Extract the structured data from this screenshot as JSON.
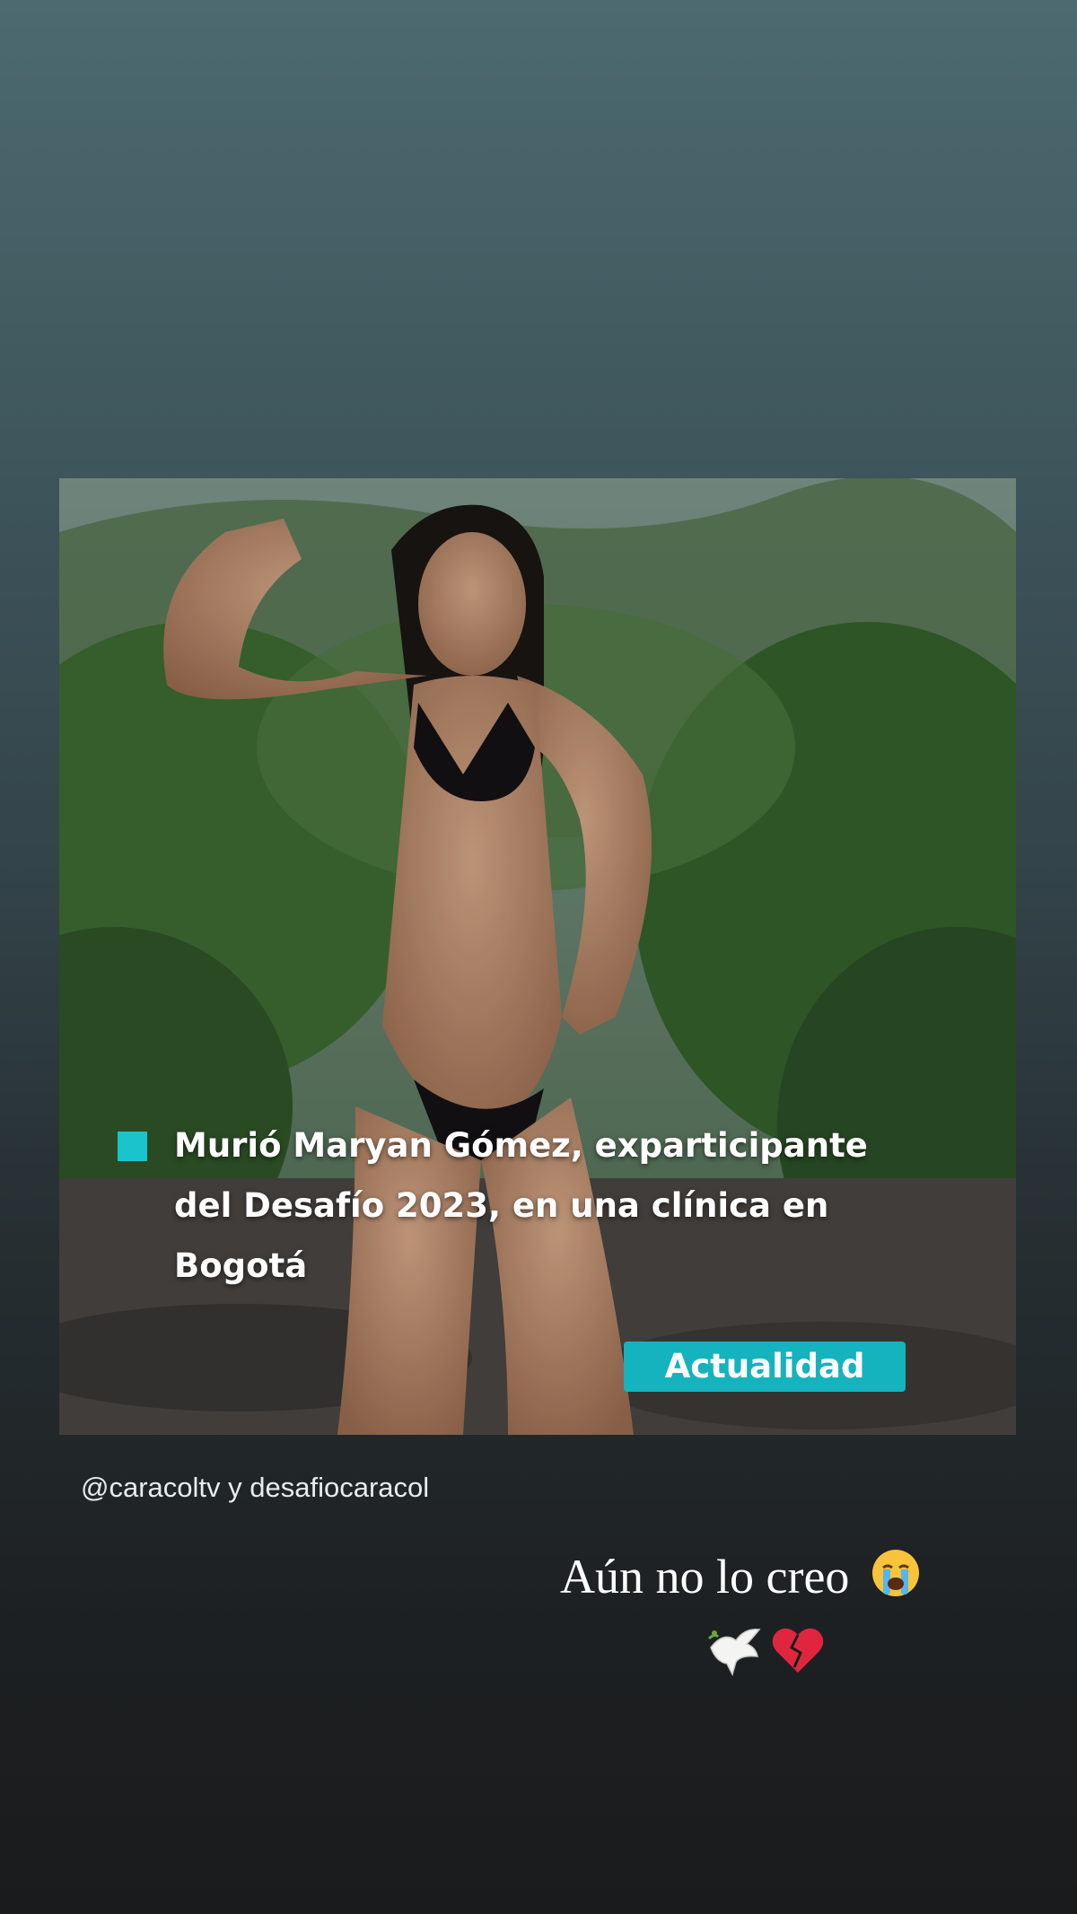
{
  "post": {
    "headline": "Murió Maryan Gómez, exparticipante del Desafío 2023, en una clínica en Bogotá",
    "category": "Actualidad",
    "accent_color": "#19c4cc"
  },
  "story": {
    "mentions": "@caracoltv y desafiocaracol",
    "caption": "Aún no lo creo",
    "caption_emoji": "crying-face-icon",
    "extra_emojis": [
      "dove-icon",
      "broken-heart-icon"
    ]
  }
}
